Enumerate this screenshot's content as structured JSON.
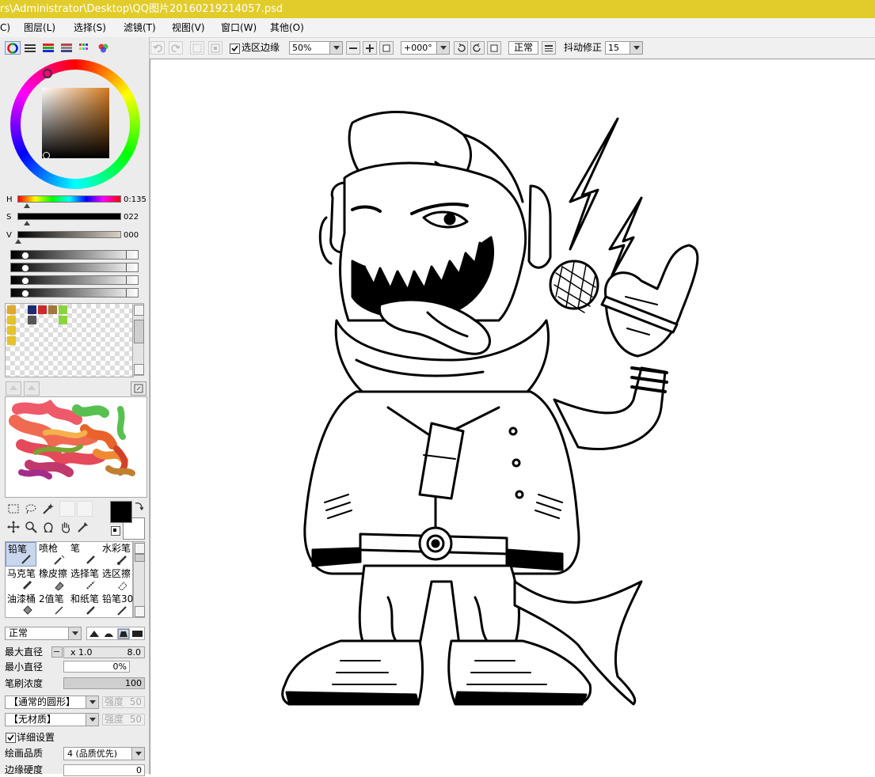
{
  "window": {
    "title": "rs\\Administrator\\Desktop\\QQ图片20160219214057.psd"
  },
  "menu": [
    {
      "label": "C)"
    },
    {
      "label": "图层(L)"
    },
    {
      "label": "选择(S)"
    },
    {
      "label": "滤镜(T)"
    },
    {
      "label": "视图(V)"
    },
    {
      "label": "窗口(W)"
    },
    {
      "label": "其他(O)"
    }
  ],
  "toolbar": {
    "selection_edge_label": "选区边缘",
    "selection_edge_checked": true,
    "zoom_value": "50%",
    "rotation_value": "+000°",
    "blend_mode": "正常",
    "stabilizer_label": "抖动修正",
    "stabilizer_value": "15"
  },
  "color_panel": {
    "h_label": "H",
    "h_value": "0:135",
    "s_label": "S",
    "s_value": "022",
    "v_label": "V",
    "v_value": "000",
    "accent_hue": "#d47a1e"
  },
  "swatches": [
    "#e0a92a",
    "#1e2a72",
    "#cc2a2a",
    "#a0783c",
    "#8ad43c",
    "#e6c228",
    "#555555",
    "#8ad43c",
    "#e6c228",
    "#e6c228"
  ],
  "tools": [
    {
      "label": "铅笔",
      "name": "tool-pencil"
    },
    {
      "label": "喷枪",
      "name": "tool-airbrush"
    },
    {
      "label": "笔",
      "name": "tool-brush"
    },
    {
      "label": "水彩笔",
      "name": "tool-watercolor"
    },
    {
      "label": "马克笔",
      "name": "tool-marker"
    },
    {
      "label": "橡皮擦",
      "name": "tool-eraser"
    },
    {
      "label": "选择笔",
      "name": "tool-select-pen"
    },
    {
      "label": "选区擦",
      "name": "tool-select-eraser"
    },
    {
      "label": "油漆桶",
      "name": "tool-bucket"
    },
    {
      "label": "2值笔",
      "name": "tool-binary-pen"
    },
    {
      "label": "和纸笔",
      "name": "tool-washi-pen"
    },
    {
      "label": "铅笔30",
      "name": "tool-pencil30"
    }
  ],
  "brush_settings": {
    "blend_mode": "正常",
    "max_size_label": "最大直径",
    "max_size_mult": "x 1.0",
    "max_size_value": "8.0",
    "min_size_label": "最小直径",
    "min_size_value": "0%",
    "density_label": "笔刷浓度",
    "density_value": "100",
    "shape": "【通常的圆形】",
    "shape_strength_label": "强度",
    "shape_strength_value": "50",
    "texture": "【无材质】",
    "texture_strength_label": "强度",
    "texture_strength_value": "50",
    "detail_label": "详细设置",
    "detail_checked": true,
    "quality_label": "绘画品质",
    "quality_value": "4 (品质优先)",
    "edge_label": "边缘硬度",
    "edge_value": "0"
  },
  "canvas": {
    "description_icon": "shark-rapper-lineart"
  }
}
